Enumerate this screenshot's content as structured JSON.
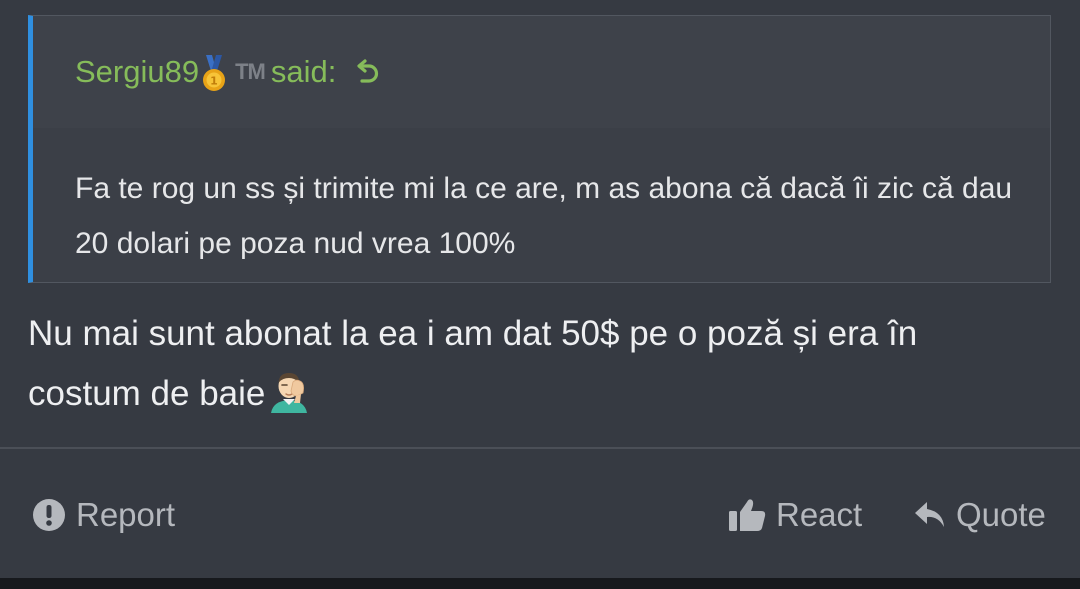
{
  "quote": {
    "author": "Sergiu89",
    "badge_icon": "medal-icon",
    "tm_label": "TM",
    "said_label": "said:",
    "jump_icon": "arrow-return-icon",
    "body": "Fa te rog un ss și trimite mi la ce are, m as abona că dacă îi zic că dau 20 dolari pe poza nud vrea 100%"
  },
  "message": {
    "text": "Nu mai sunt abonat la ea i am dat 50$ pe o poză și era în costum de baie",
    "emoji": "facepalm-icon"
  },
  "actions": {
    "report_label": "Report",
    "react_label": "React",
    "quote_label": "Quote"
  },
  "colors": {
    "background": "#363a42",
    "quote_border_accent": "#2f8fe0",
    "author_green": "#86bc5a",
    "action_gray": "#b5b8bd"
  }
}
